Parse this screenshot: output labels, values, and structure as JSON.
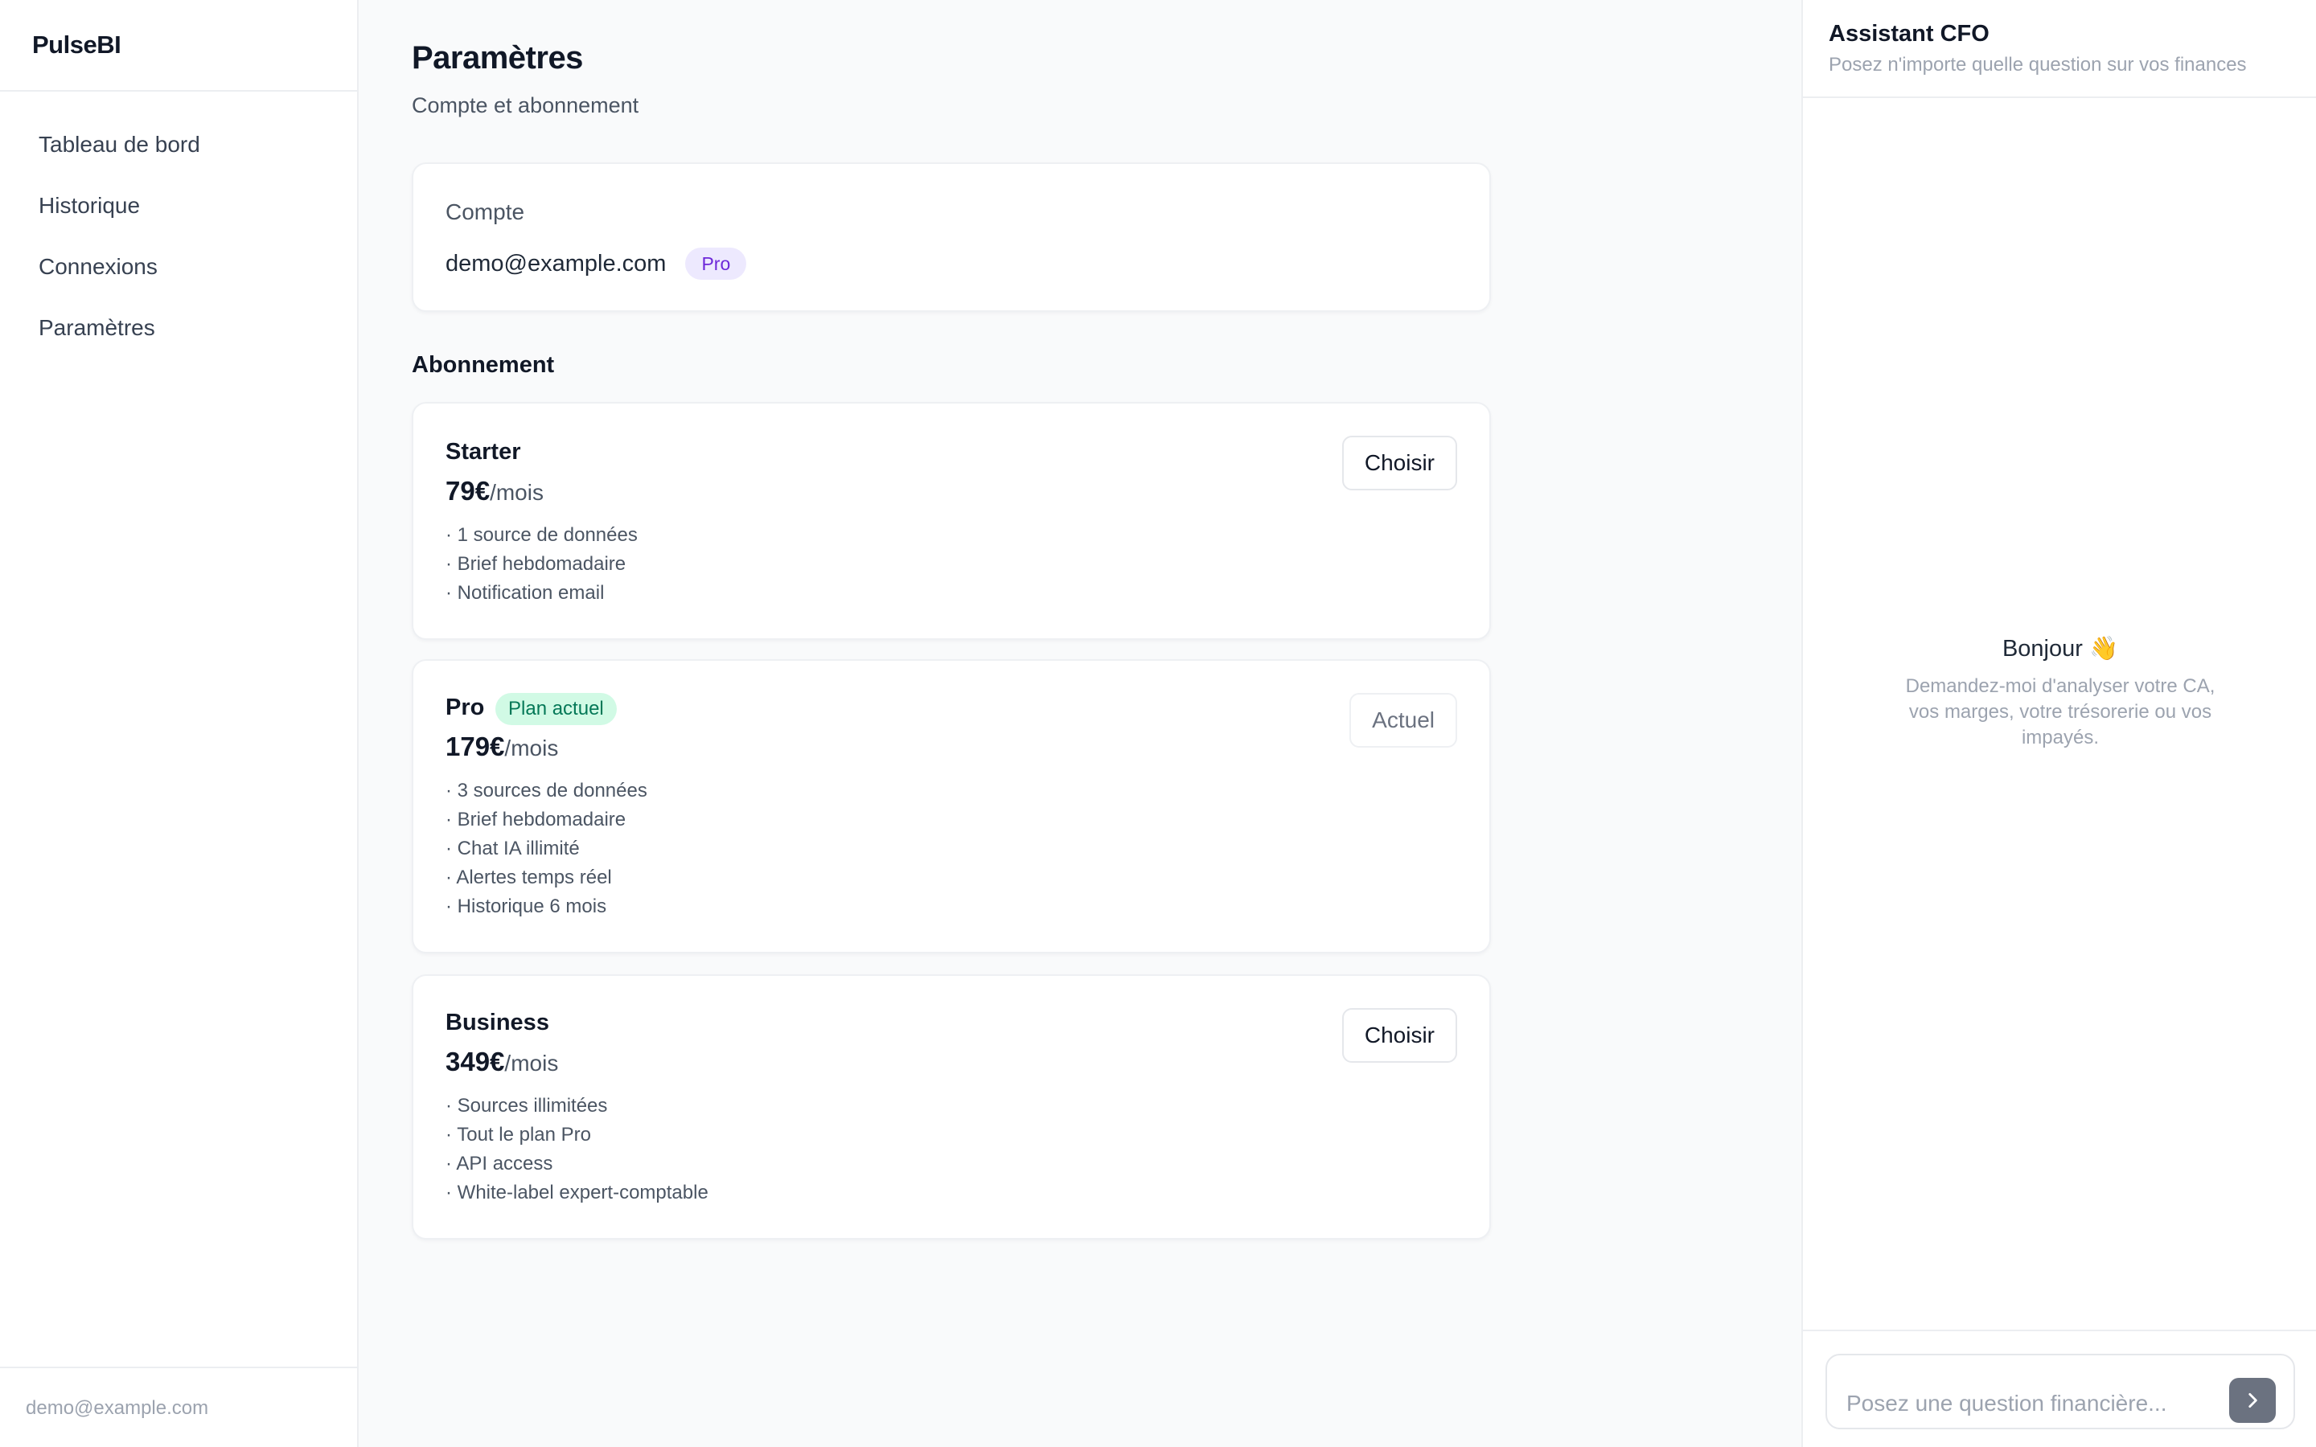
{
  "app": {
    "brand": "PulseBI"
  },
  "sidebar": {
    "items": [
      {
        "label": "Tableau de bord"
      },
      {
        "label": "Historique"
      },
      {
        "label": "Connexions"
      },
      {
        "label": "Paramètres"
      }
    ],
    "footer_email": "demo@example.com"
  },
  "page": {
    "title": "Paramètres",
    "subtitle": "Compte et abonnement"
  },
  "account": {
    "label": "Compte",
    "email": "demo@example.com",
    "plan_badge": "Pro"
  },
  "subscription": {
    "section_title": "Abonnement",
    "plans": [
      {
        "name": "Starter",
        "price": "79€",
        "unit": "/mois",
        "button": "Choisir",
        "features": [
          "· 1 source de données",
          "· Brief hebdomadaire",
          "· Notification email"
        ]
      },
      {
        "name": "Pro",
        "badge": "Plan actuel",
        "price": "179€",
        "unit": "/mois",
        "button": "Actuel",
        "features": [
          "· 3 sources de données",
          "· Brief hebdomadaire",
          "· Chat IA illimité",
          "· Alertes temps réel",
          "· Historique 6 mois"
        ]
      },
      {
        "name": "Business",
        "price": "349€",
        "unit": "/mois",
        "button": "Choisir",
        "features": [
          "· Sources illimitées",
          "· Tout le plan Pro",
          "· API access",
          "· White-label expert-comptable"
        ]
      }
    ]
  },
  "assistant": {
    "title": "Assistant CFO",
    "subtitle": "Posez n'importe quelle question sur vos finances",
    "greeting": "Bonjour 👋",
    "hint": "Demandez-moi d'analyser votre CA, vos marges, votre trésorerie ou vos impayés.",
    "input_placeholder": "Posez une question financière...",
    "send_icon": "chevron-right-icon"
  },
  "colors": {
    "background": "#f9fafb",
    "badge_pro_bg": "#ede9fe",
    "badge_pro_text": "#6d28d9",
    "badge_current_bg": "#d1fae5",
    "badge_current_text": "#047857",
    "send_button": "#6b7280"
  }
}
